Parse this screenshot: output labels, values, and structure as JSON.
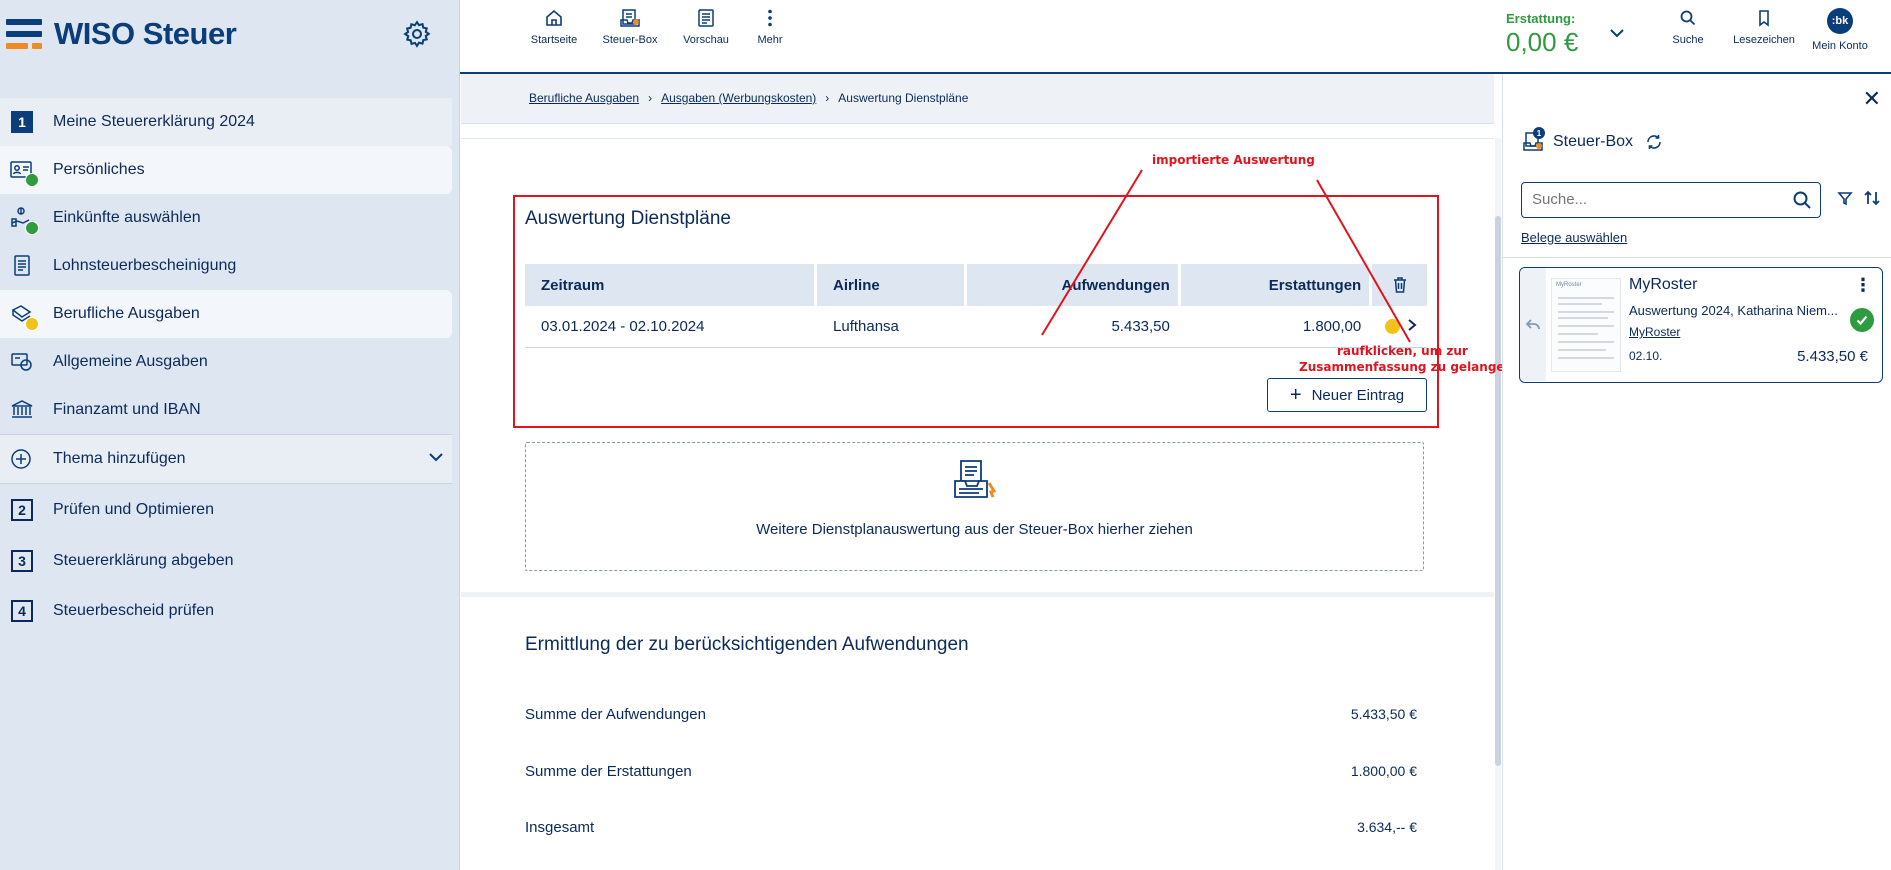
{
  "app": {
    "logo_text": "WISO Steuer"
  },
  "sidebar": {
    "items": [
      {
        "label": "Meine Steuererklärung 2024",
        "number": "1"
      },
      {
        "label": "Persönliches"
      },
      {
        "label": "Einkünfte auswählen"
      },
      {
        "label": "Lohnsteuerbescheinigung"
      },
      {
        "label": "Berufliche Ausgaben"
      },
      {
        "label": "Allgemeine Ausgaben"
      },
      {
        "label": "Finanzamt und IBAN"
      },
      {
        "label": "Thema hinzufügen"
      },
      {
        "label": "Prüfen und Optimieren",
        "number": "2"
      },
      {
        "label": "Steuererklärung abgeben",
        "number": "3"
      },
      {
        "label": "Steuerbescheid prüfen",
        "number": "4"
      }
    ]
  },
  "toolbar": {
    "start": "Startseite",
    "steuerbox": "Steuer-Box",
    "preview": "Vorschau",
    "more": "Mehr",
    "refund_label": "Erstattung:",
    "refund_value": "0,00 €",
    "search": "Suche",
    "bookmarks": "Lesezeichen",
    "account": "Mein Konto",
    "account_initials": ":bk"
  },
  "breadcrumb": {
    "items": [
      "Berufliche Ausgaben",
      "Ausgaben (Werbungskosten)",
      "Auswertung Dienstpläne"
    ]
  },
  "section1": {
    "title": "Auswertung Dienstpläne",
    "columns": [
      "Zeitraum",
      "Airline",
      "Aufwendungen",
      "Erstattungen"
    ],
    "rows": [
      {
        "period": "03.01.2024 - 02.10.2024",
        "airline": "Lufthansa",
        "expenses": "5.433,50",
        "refunds": "1.800,00"
      }
    ],
    "new_entry": "Neuer Eintrag",
    "dropzone_text": "Weitere Dienstplanauswertung aus der Steuer-Box hierher ziehen"
  },
  "annotations": {
    "imported": "importierte Auswertung",
    "click_line1": "raufklicken, um zur",
    "click_line2": "Zusammenfassung zu gelangen"
  },
  "section2": {
    "title": "Ermittlung der zu berücksichtigenden Aufwendungen",
    "rows": [
      {
        "label": "Summe der Aufwendungen",
        "value": "5.433,50 €"
      },
      {
        "label": "Summe der Erstattungen",
        "value": "1.800,00 €"
      },
      {
        "label": "Insgesamt",
        "value": "3.634,-- €"
      }
    ]
  },
  "steuerbox_panel": {
    "title": "Steuer-Box",
    "count": "1",
    "search_placeholder": "Suche...",
    "select_link": "Belege auswählen",
    "document": {
      "title": "MyRoster",
      "subtitle": "Auswertung 2024, Katharina Niem...",
      "link": "MyRoster",
      "date": "02.10.",
      "amount": "5.433,50 €",
      "thumb_text": "MyRoster"
    }
  },
  "colors": {
    "brand": "#0b3d7a",
    "accent": "#f08a24",
    "success": "#2e9b3f",
    "warning": "#f2c21b",
    "annotation": "#e0141e"
  }
}
